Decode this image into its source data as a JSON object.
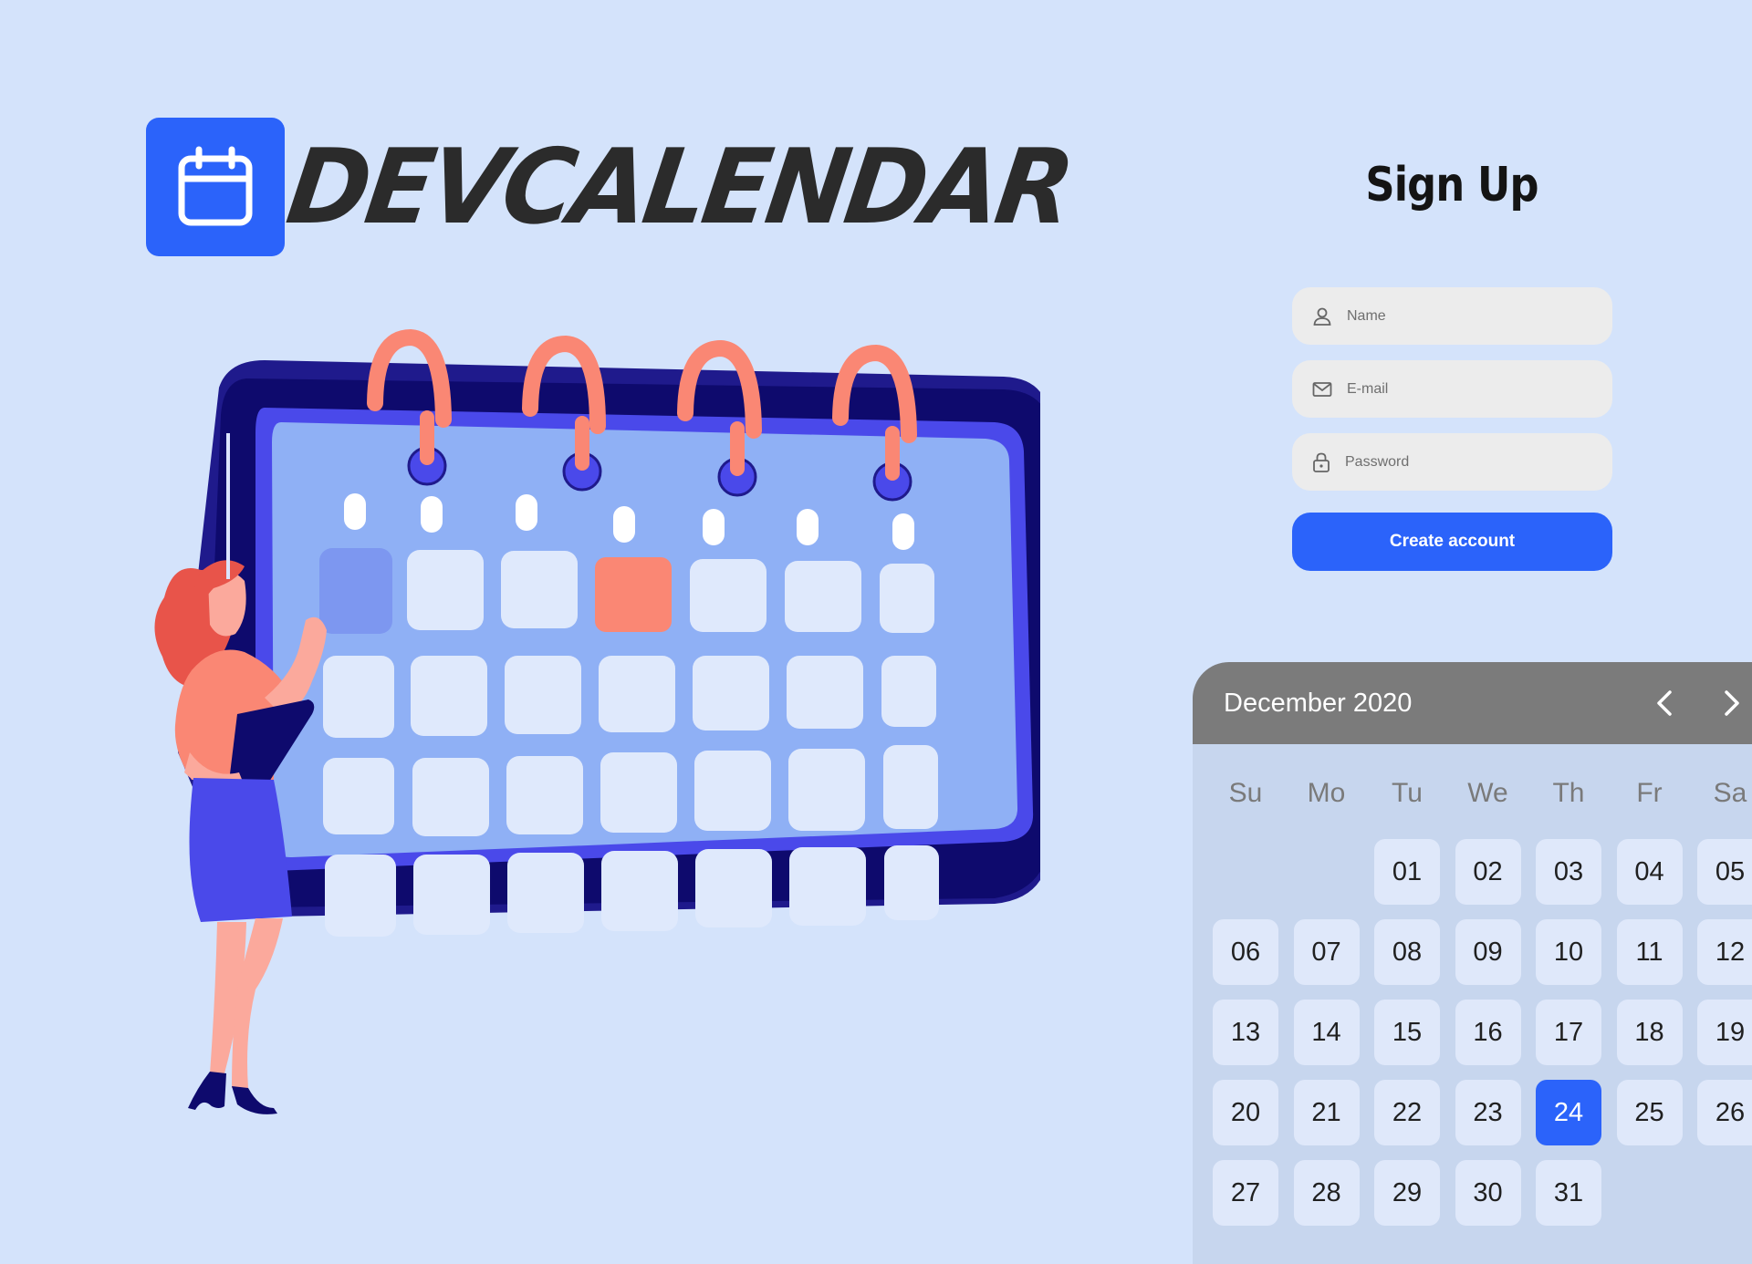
{
  "app": {
    "brand_name": "DevCalendar",
    "accent_color": "#2b63fa",
    "background_color": "#d4e3fb"
  },
  "logo": {
    "icon": "calendar-icon"
  },
  "signup": {
    "title": "Sign Up",
    "name_field": {
      "placeholder": "Name",
      "value": "",
      "icon": "user-icon"
    },
    "email_field": {
      "placeholder": "E-mail",
      "value": "",
      "icon": "mail-icon"
    },
    "password_field": {
      "placeholder": "Password",
      "value": "",
      "icon": "lock-icon"
    },
    "submit_label": "Create account"
  },
  "datepicker": {
    "month_label": "December 2020",
    "prev_icon": "chevron-left-icon",
    "next_icon": "chevron-right-icon",
    "weekdays": [
      "Su",
      "Mo",
      "Tu",
      "We",
      "Th",
      "Fr",
      "Sa"
    ],
    "first_weekday_index": 2,
    "days": [
      "01",
      "02",
      "03",
      "04",
      "05",
      "06",
      "07",
      "08",
      "09",
      "10",
      "11",
      "12",
      "13",
      "14",
      "15",
      "16",
      "17",
      "18",
      "19",
      "20",
      "21",
      "22",
      "23",
      "24",
      "25",
      "26",
      "27",
      "28",
      "29",
      "30",
      "31"
    ],
    "selected_day": "24"
  }
}
